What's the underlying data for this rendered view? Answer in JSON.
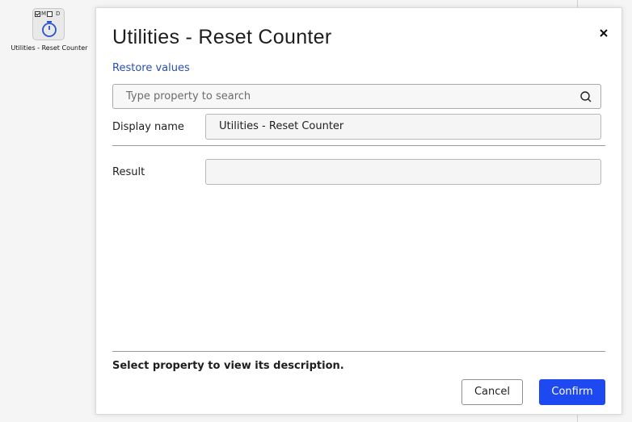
{
  "canvas": {
    "node": {
      "flag_m": "M",
      "flag_d": "D",
      "flag_m_checked": true,
      "flag_d_checked": false,
      "icon": "stopwatch-icon",
      "label": "Utilities - Reset Counter"
    }
  },
  "dialog": {
    "title": "Utilities - Reset Counter",
    "close_icon": "close-icon",
    "restore_label": "Restore values",
    "search": {
      "placeholder": "Type property to search",
      "value": "",
      "icon": "search-icon"
    },
    "properties": [
      {
        "label": "Display name",
        "value": "Utilities - Reset Counter"
      },
      {
        "label": "Result",
        "value": ""
      }
    ],
    "description": "Select property to view its description.",
    "buttons": {
      "cancel": "Cancel",
      "confirm": "Confirm"
    },
    "colors": {
      "link": "#2a4fb4",
      "confirm_bg": "#1f49f0"
    }
  }
}
